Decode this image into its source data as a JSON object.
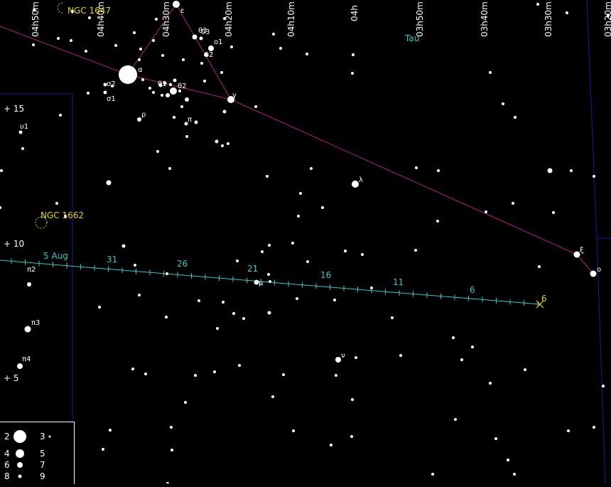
{
  "colors": {
    "background": "#000000",
    "star": "#ffffff",
    "constellation_line": "#b0208f",
    "boundary": "#1a1aa8",
    "path": "#36c9c9",
    "path_label": "#36c9c9",
    "end_label": "#e6d21e",
    "dso": "#e6d21e",
    "constellation_label": "#36c9c9"
  },
  "ra_labels": [
    "04h50m",
    "04h40m",
    "04h30m",
    "04h20m",
    "04h10m",
    "04h",
    "03h50m",
    "03h40m",
    "03h30m",
    "03h20m"
  ],
  "dec_labels": [
    "+ 15",
    "+ 10",
    "+ 5"
  ],
  "constellation_name": "Tau",
  "dso_labels": [
    "NGC 1647",
    "NGC 1662"
  ],
  "path_date_labels": [
    "5 Aug",
    "31",
    "26",
    "21",
    "16",
    "11",
    "6"
  ],
  "path_end_label": "6",
  "star_labels": [
    "ε",
    "θ3",
    "ο1",
    "δ2",
    "α",
    "σ2",
    "σ1",
    "θ1",
    "θ2",
    "γ",
    "ρ",
    "π",
    "υ1",
    "λ",
    "π2",
    "π3",
    "π4",
    "μ",
    "ν",
    "ξ",
    "ο",
    "δ3"
  ],
  "legend": {
    "magnitudes": [
      "2",
      "3",
      "4",
      "5",
      "6",
      "7",
      "8",
      "9"
    ]
  }
}
